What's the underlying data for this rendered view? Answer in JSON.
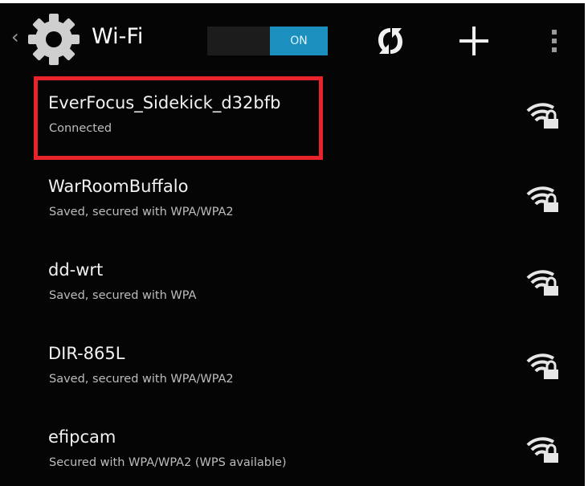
{
  "action_bar": {
    "title": "Wi-Fi",
    "toggle_label": "ON",
    "icons": [
      "up-caret-icon",
      "settings-gear-icon",
      "wps-icon",
      "add-icon",
      "overflow-menu-icon"
    ]
  },
  "networks": [
    {
      "ssid": "EverFocus_Sidekick_d32bfb",
      "status": "Connected",
      "icon": "wifi-secured-icon"
    },
    {
      "ssid": "WarRoomBuffalo",
      "status": "Saved, secured with WPA/WPA2",
      "icon": "wifi-secured-icon"
    },
    {
      "ssid": "dd-wrt",
      "status": "Saved, secured with WPA",
      "icon": "wifi-secured-icon"
    },
    {
      "ssid": "DIR-865L",
      "status": "Saved, secured with WPA/WPA2",
      "icon": "wifi-secured-icon"
    },
    {
      "ssid": "efipcam",
      "status": "Secured with WPA/WPA2 (WPS available)",
      "icon": "wifi-secured-icon"
    }
  ],
  "colors": {
    "background": "#050505",
    "accent": "#1b8fbe",
    "highlight": "#e8232a",
    "text_primary": "#f2f2f2",
    "text_secondary": "#bdbdbd"
  }
}
